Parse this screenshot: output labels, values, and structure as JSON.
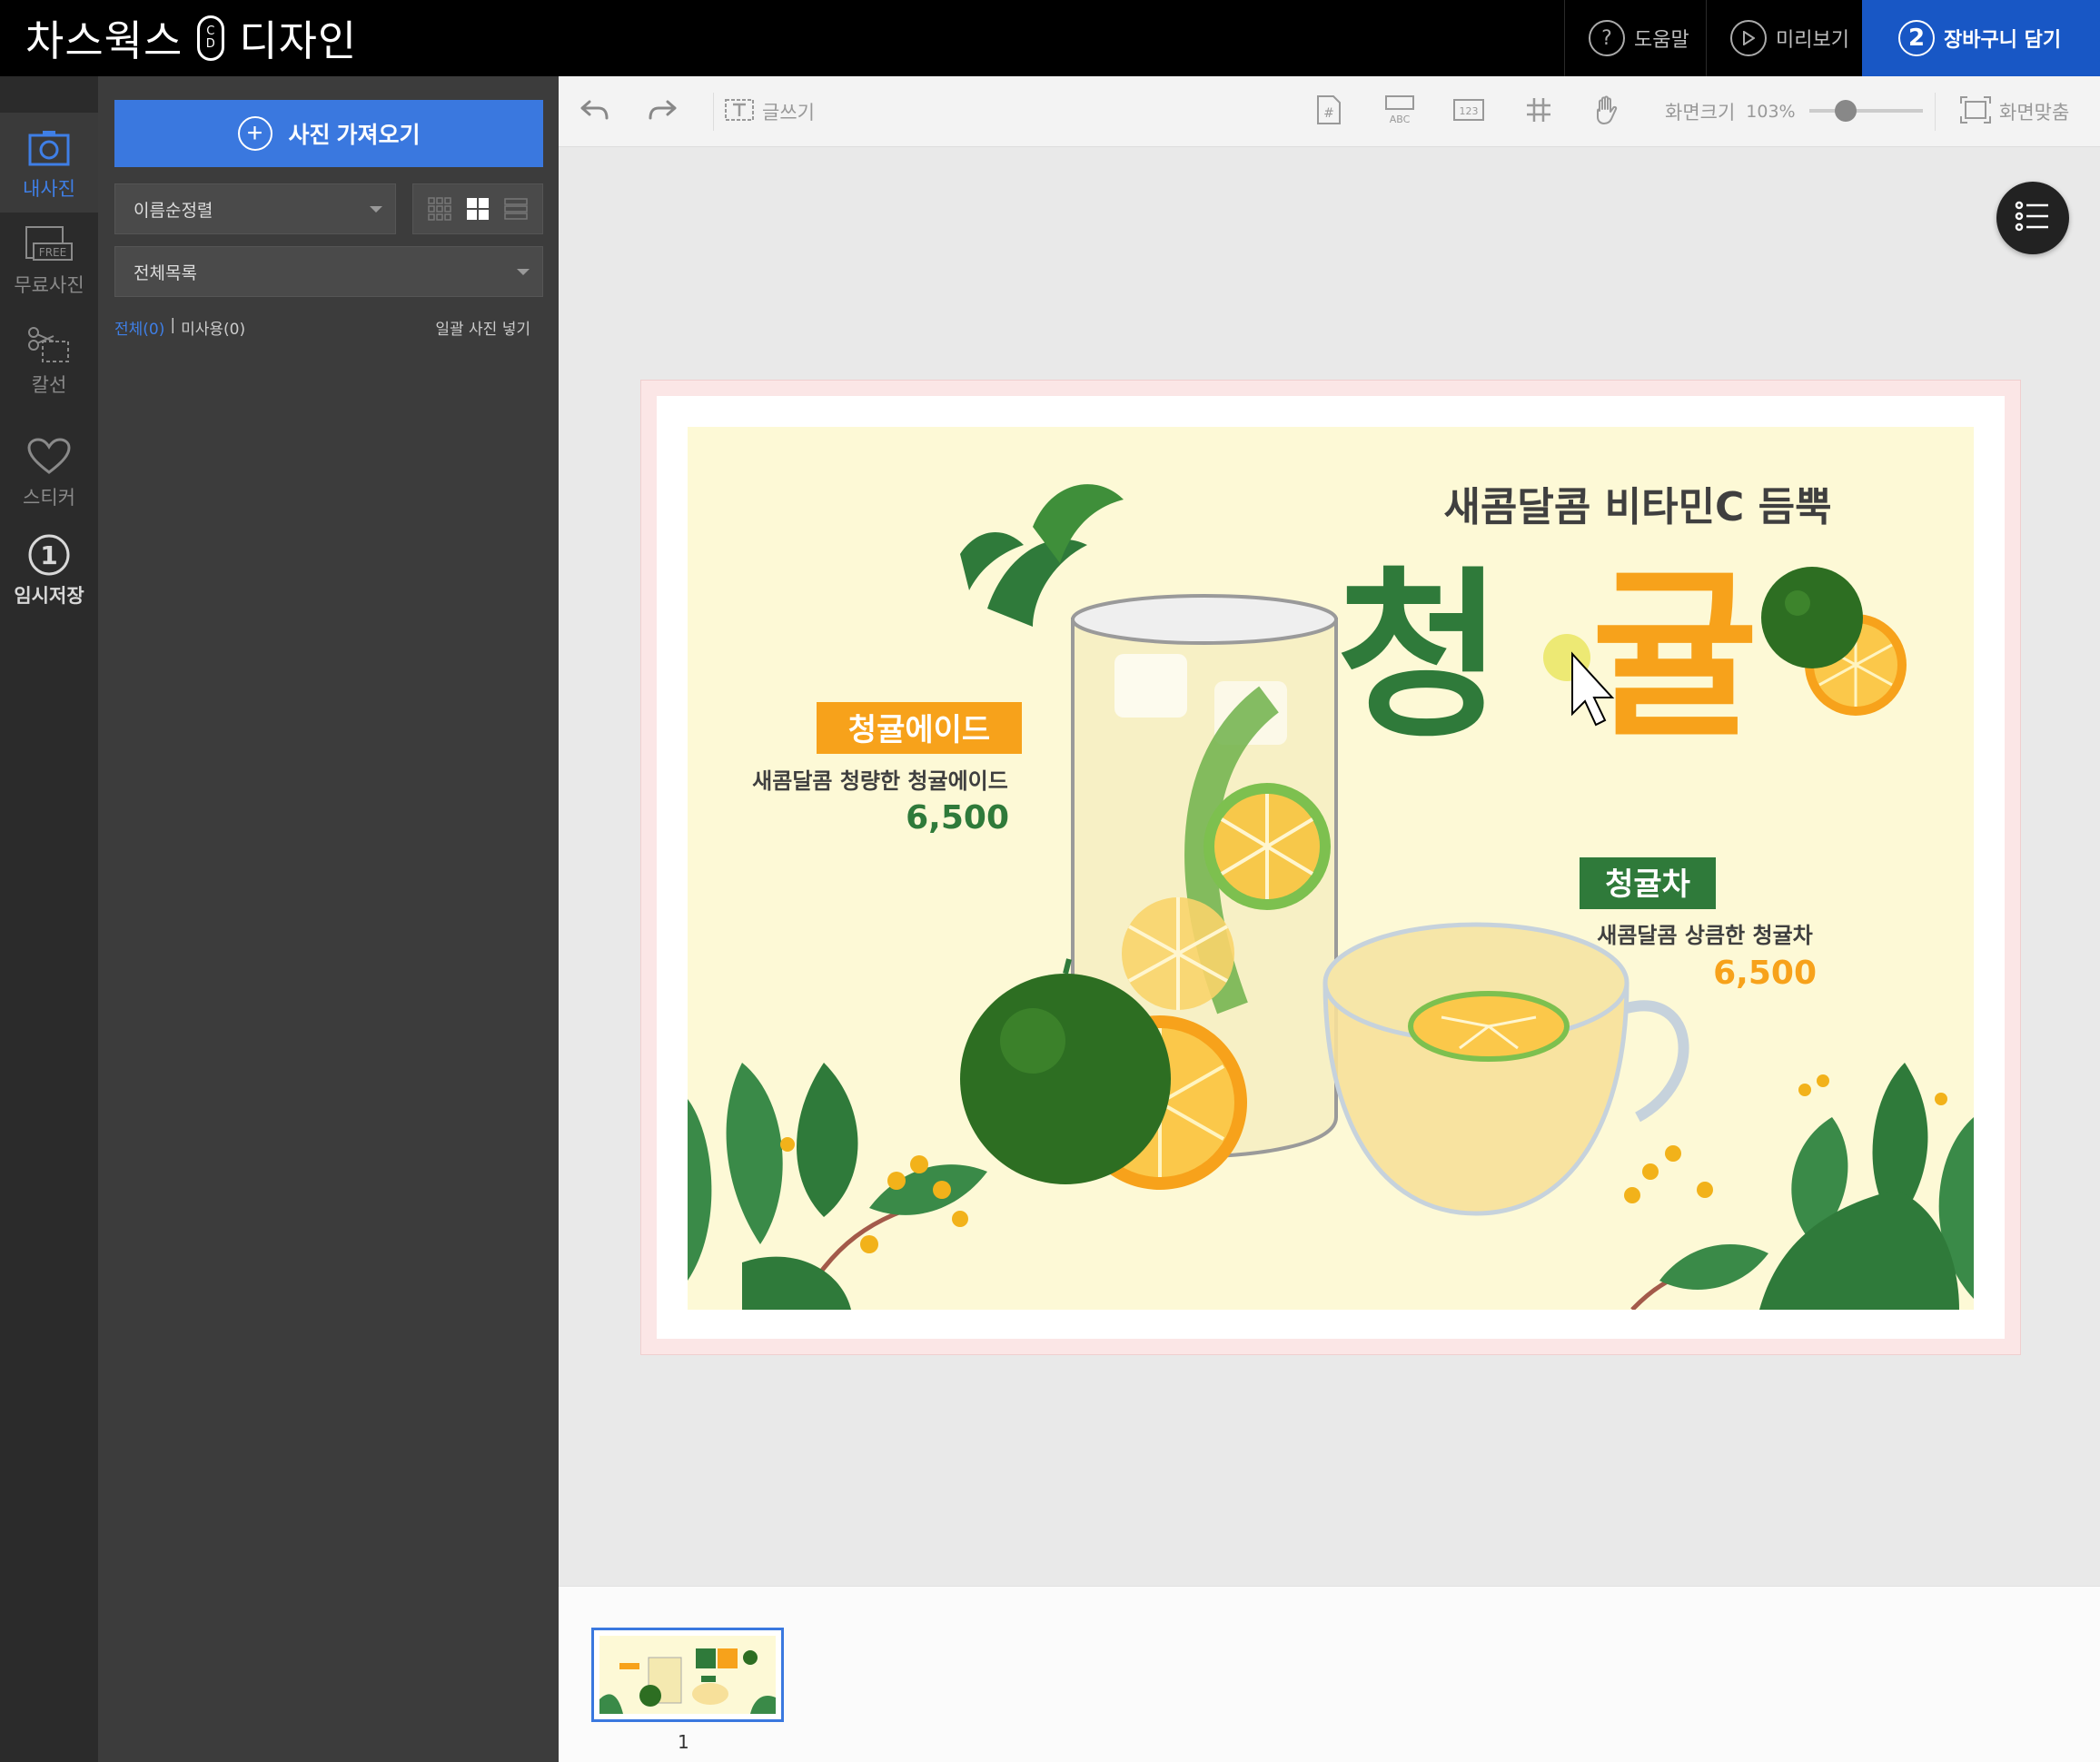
{
  "header": {
    "brand_left": "차스웍스",
    "brand_logo_top": "C",
    "brand_logo_bottom": "D",
    "brand_right": "디자인",
    "help_label": "도움말",
    "preview_label": "미리보기",
    "cart_step": "2",
    "cart_label": "장바구니 담기"
  },
  "rail": {
    "items": [
      {
        "label": "내사진",
        "icon": "camera-icon"
      },
      {
        "label": "무료사진",
        "icon": "free-photo-icon",
        "badge": "FREE"
      },
      {
        "label": "칼선",
        "icon": "scissors-icon"
      },
      {
        "label": "스티커",
        "icon": "heart-icon"
      },
      {
        "label": "임시저장",
        "icon": "save-number-icon",
        "number": "1"
      }
    ]
  },
  "panel": {
    "import_label": "사진 가져오기",
    "sort_value": "이름순정렬",
    "list_value": "전체목록",
    "filter_all": "전체(0)",
    "filter_separator": "|",
    "filter_unused": "미사용(0)",
    "bulk_insert": "일괄 사진 넣기"
  },
  "toolbar": {
    "text_tool": "글쓰기",
    "zoom_label": "화면크기",
    "zoom_value": "103%",
    "fit_label": "화면맞춤",
    "abc": "ABC",
    "num": "123"
  },
  "design": {
    "headline": "새콤달콤 비타민C 듬뿍",
    "title_part1": "청",
    "title_part2": "귤",
    "product1": {
      "name": "청귤에이드",
      "desc": "새콤달콤 청량한 청귤에이드",
      "price": "6,500"
    },
    "product2": {
      "name": "청귤차",
      "desc": "새콤달콤 상큼한 청귤차",
      "price": "6,500"
    },
    "colors": {
      "background": "#fdf9d6",
      "green": "#2f7a3a",
      "orange": "#f7a21b",
      "dark_text": "#3f3f3f"
    }
  },
  "thumbnails": [
    {
      "page": "1"
    }
  ],
  "colors": {
    "accent": "#3a78df",
    "cart": "#1857c5",
    "panel": "#3c3c3c",
    "rail": "#2b2b2b"
  }
}
